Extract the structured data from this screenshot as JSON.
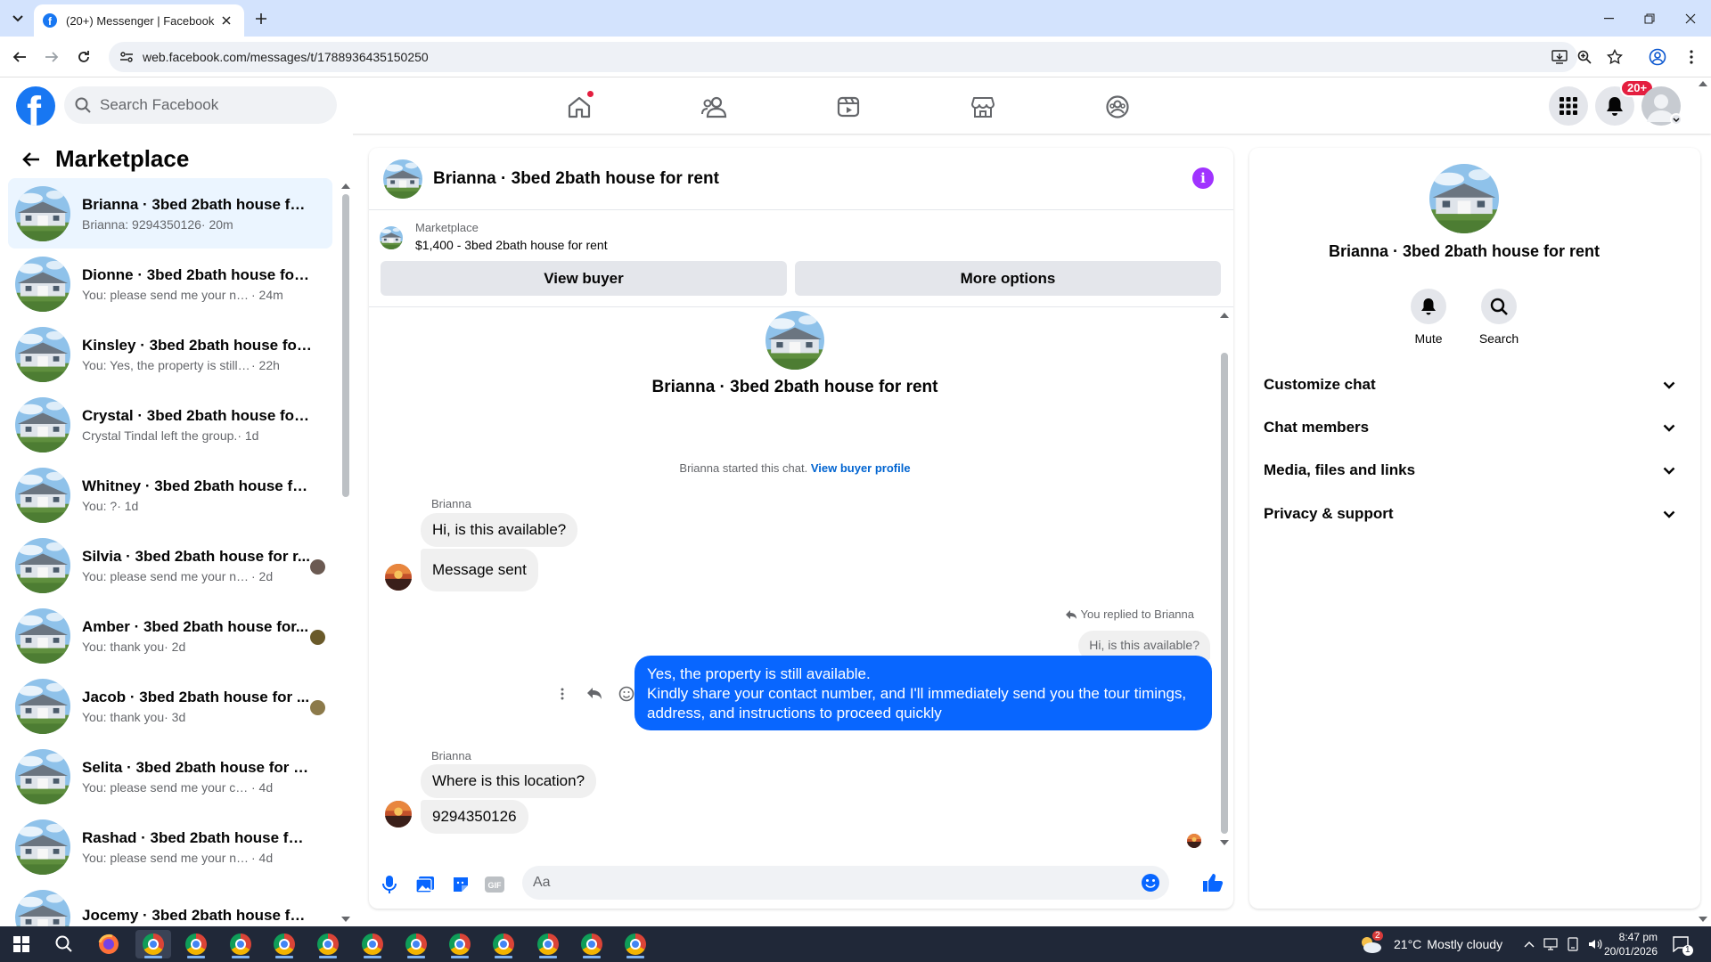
{
  "browser": {
    "tab_title": "(20+) Messenger | Facebook",
    "url": "web.facebook.com/messages/t/1788936435150250"
  },
  "header": {
    "search_placeholder": "Search Facebook",
    "notifications_badge": "20+"
  },
  "left": {
    "title": "Marketplace",
    "conversations": [
      {
        "name": "Brianna · 3bed 2bath house for r...",
        "snippet": "Brianna: 9294350126",
        "time": "· 20m",
        "active": true
      },
      {
        "name": "Dionne · 3bed 2bath house for r...",
        "snippet": "You: please send me your number",
        "time": "· 24m"
      },
      {
        "name": "Kinsley · 3bed 2bath house for r...",
        "snippet": "You: Yes, the property is still availa...",
        "time": "· 22h"
      },
      {
        "name": "Crystal · 3bed 2bath house for r...",
        "snippet": "Crystal Tindal left the group.",
        "time": "· 1d"
      },
      {
        "name": "Whitney · 3bed 2bath house for ...",
        "snippet": "You: ?",
        "time": "· 1d"
      },
      {
        "name": "Silvia · 3bed 2bath house for r...",
        "snippet": "You: please send me your numb...",
        "time": "· 2d"
      },
      {
        "name": "Amber · 3bed 2bath house for...",
        "snippet": "You: thank you",
        "time": "· 2d"
      },
      {
        "name": "Jacob · 3bed 2bath house for ...",
        "snippet": "You: thank you",
        "time": "· 3d"
      },
      {
        "name": "Selita · 3bed 2bath house for rent",
        "snippet": "You: please send me your contact n...",
        "time": "· 4d"
      },
      {
        "name": "Rashad · 3bed 2bath house for r...",
        "snippet": "You: please send me your number...",
        "time": "· 4d"
      },
      {
        "name": "Jocemy · 3bed 2bath house for r...",
        "snippet": "",
        "time": ""
      }
    ]
  },
  "chat": {
    "title": "Brianna · 3bed 2bath house for rent",
    "listing_label": "Marketplace",
    "listing_detail": "$1,400 - 3bed 2bath house for rent",
    "view_buyer": "View buyer",
    "more_options": "More options",
    "started_note": "Brianna started this chat.",
    "view_buyer_profile": "View buyer profile",
    "sender1": "Brianna",
    "msg1": "Hi, is this available?",
    "msg2": "Message sent",
    "replied_note": "You replied to Brianna",
    "quoted": "Hi, is this available?",
    "reply_line1": "Yes, the property is still available.",
    "reply_line2": "Kindly share your contact number, and I'll immediately send you the tour timings, address, and instructions to proceed quickly",
    "sender2": "Brianna",
    "msg3": "Where is this location?",
    "msg4": "9294350126",
    "composer_placeholder": "Aa"
  },
  "right": {
    "name": "Brianna · 3bed 2bath house for rent",
    "mute": "Mute",
    "search": "Search",
    "sections": [
      "Customize chat",
      "Chat members",
      "Media, files and links",
      "Privacy & support"
    ]
  },
  "taskbar": {
    "weather_temp": "21°C",
    "weather_text": "Mostly cloudy",
    "weather_badge": "2",
    "time": "8:47 pm",
    "date": "20/01/2026",
    "notif_count": "1"
  },
  "colors": {
    "fb_blue": "#1877f2",
    "bubble_blue": "#0866ff",
    "active_row": "#ebf5ff",
    "taskbar": "#202838"
  }
}
